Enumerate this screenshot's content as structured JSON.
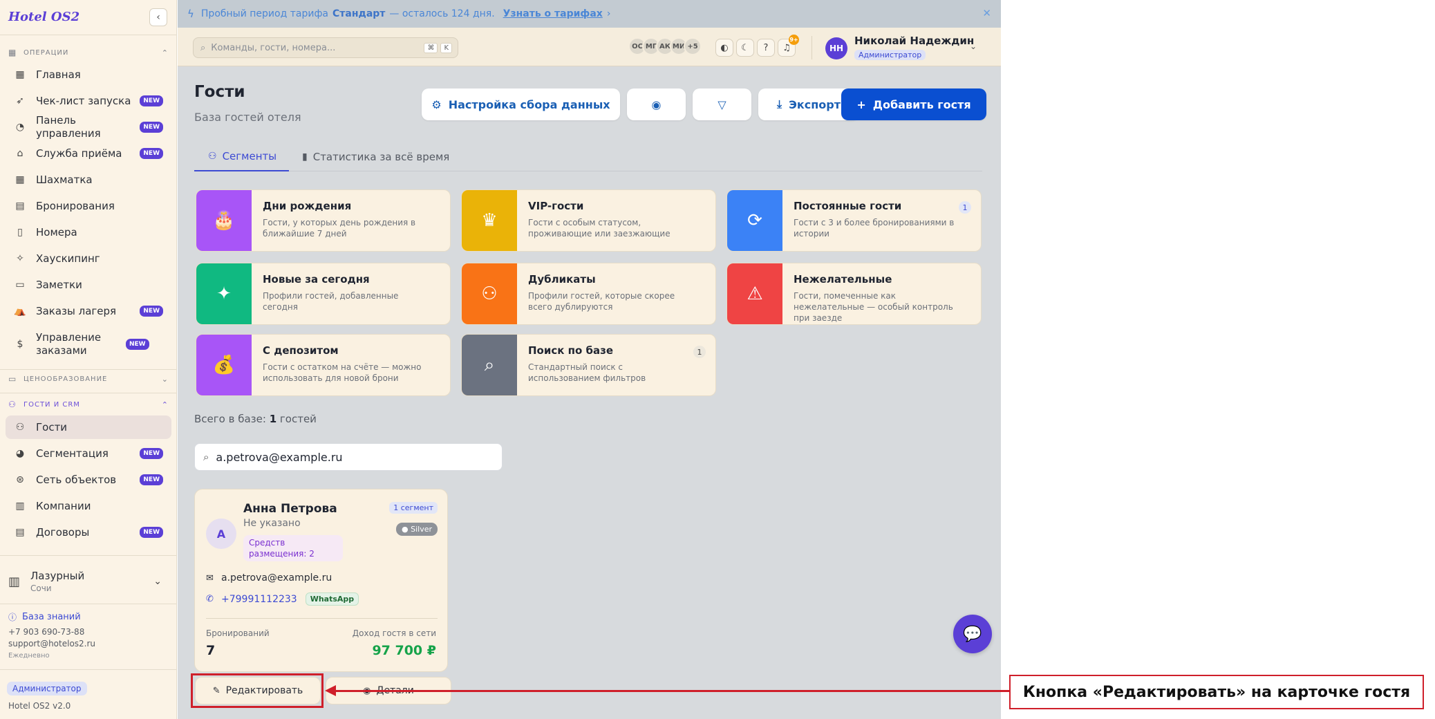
{
  "sidebar": {
    "logo": "Hotel OS2",
    "sections": {
      "operations": "ОПЕРАЦИИ",
      "pricing": "ЦЕНООБРАЗОВАНИЕ",
      "crm": "ГОСТИ И CRM"
    },
    "items": [
      {
        "label": "Главная",
        "badge": ""
      },
      {
        "label": "Чек-лист запуска",
        "badge": "NEW"
      },
      {
        "label": "Панель управления",
        "badge": "NEW"
      },
      {
        "label": "Служба приёма",
        "badge": "NEW"
      },
      {
        "label": "Шахматка",
        "badge": ""
      },
      {
        "label": "Бронирования",
        "badge": ""
      },
      {
        "label": "Номера",
        "badge": ""
      },
      {
        "label": "Хаускипинг",
        "badge": ""
      },
      {
        "label": "Заметки",
        "badge": ""
      },
      {
        "label": "Заказы лагеря",
        "badge": "NEW"
      },
      {
        "label": "Управление заказами",
        "badge": "NEW"
      }
    ],
    "crm_items": [
      {
        "label": "Гости",
        "badge": ""
      },
      {
        "label": "Сегментация",
        "badge": "NEW"
      },
      {
        "label": "Сеть объектов",
        "badge": "NEW"
      },
      {
        "label": "Компании",
        "badge": ""
      },
      {
        "label": "Договоры",
        "badge": "NEW"
      }
    ],
    "hotel": {
      "name": "Лазурный",
      "city": "Сочи"
    },
    "knowledge_base": "База знаний",
    "phone": "+7 903 690-73-88",
    "email": "support@hotelos2.ru",
    "schedule": "Ежедневно",
    "role": "Администратор",
    "version": "Hotel OS2 v2.0"
  },
  "trial": {
    "prefix": "Пробный период тарифа",
    "plan": "Стандарт",
    "suffix": "— осталось 124 дня.",
    "link": "Узнать о тарифах"
  },
  "topbar": {
    "search_placeholder": "Команды, гости, номера...",
    "kbd1": "⌘",
    "kbd2": "K",
    "avatars": [
      "ОС",
      "МГ",
      "АК",
      "МИ",
      "+5"
    ],
    "notif_count": "9+",
    "user_initials": "НН",
    "user_name": "Николай Надеждин",
    "user_role": "Администратор"
  },
  "page": {
    "title": "Гости",
    "subtitle": "База гостей отеля",
    "btn_settings": "Настройка сбора данных",
    "btn_export": "Экспорт",
    "btn_add": "Добавить гостя",
    "tab_segments": "Сегменты",
    "tab_stats": "Статистика за всё время"
  },
  "segments": [
    {
      "title": "Дни рождения",
      "desc": "Гости, у которых день рождения в ближайшие 7 дней",
      "count": "",
      "color": "#a855f7",
      "icon": "cake-icon"
    },
    {
      "title": "VIP-гости",
      "desc": "Гости с особым статусом, проживающие или заезжающие",
      "count": "",
      "color": "#eab308",
      "icon": "crown-icon"
    },
    {
      "title": "Постоянные гости",
      "desc": "Гости с 3 и более бронированиями в истории",
      "count": "1",
      "color": "#3b82f6",
      "icon": "refresh-icon"
    },
    {
      "title": "Новые за сегодня",
      "desc": "Профили гостей, добавленные сегодня",
      "count": "",
      "color": "#10b981",
      "icon": "sparkles-icon"
    },
    {
      "title": "Дубликаты",
      "desc": "Профили гостей, которые скорее всего дублируются",
      "count": "",
      "color": "#f97316",
      "icon": "users-icon"
    },
    {
      "title": "Нежелательные",
      "desc": "Гости, помеченные как нежелательные — особый контроль при заезде",
      "count": "",
      "color": "#ef4444",
      "icon": "warning-icon"
    },
    {
      "title": "С депозитом",
      "desc": "Гости с остатком на счёте — можно использовать для новой брони",
      "count": "",
      "color": "#a855f7",
      "icon": "money-bag-icon"
    },
    {
      "title": "Поиск по базе",
      "desc": "Стандартный поиск с использованием фильтров",
      "count": "1",
      "color": "#6b7280",
      "icon": "search-icon"
    }
  ],
  "total": {
    "prefix": "Всего в базе:",
    "count": "1",
    "suffix": "гостей"
  },
  "guest_search_value": "a.petrova@example.ru",
  "guest": {
    "initial": "А",
    "name": "Анна Петрова",
    "sub": "Не указано",
    "tag": "Средств размещения: 2",
    "segments": "1 сегмент",
    "tier": "Silver",
    "email": "a.petrova@example.ru",
    "phone": "+79991112233",
    "whatsapp": "WhatsApp",
    "bookings_label": "Бронирований",
    "bookings_value": "7",
    "income_label": "Доход гостя в сети",
    "income_value": "97 700 ₽",
    "edit_btn": "Редактировать",
    "details_btn": "Детали"
  },
  "callout": "Кнопка «Редактировать» на карточке гостя"
}
